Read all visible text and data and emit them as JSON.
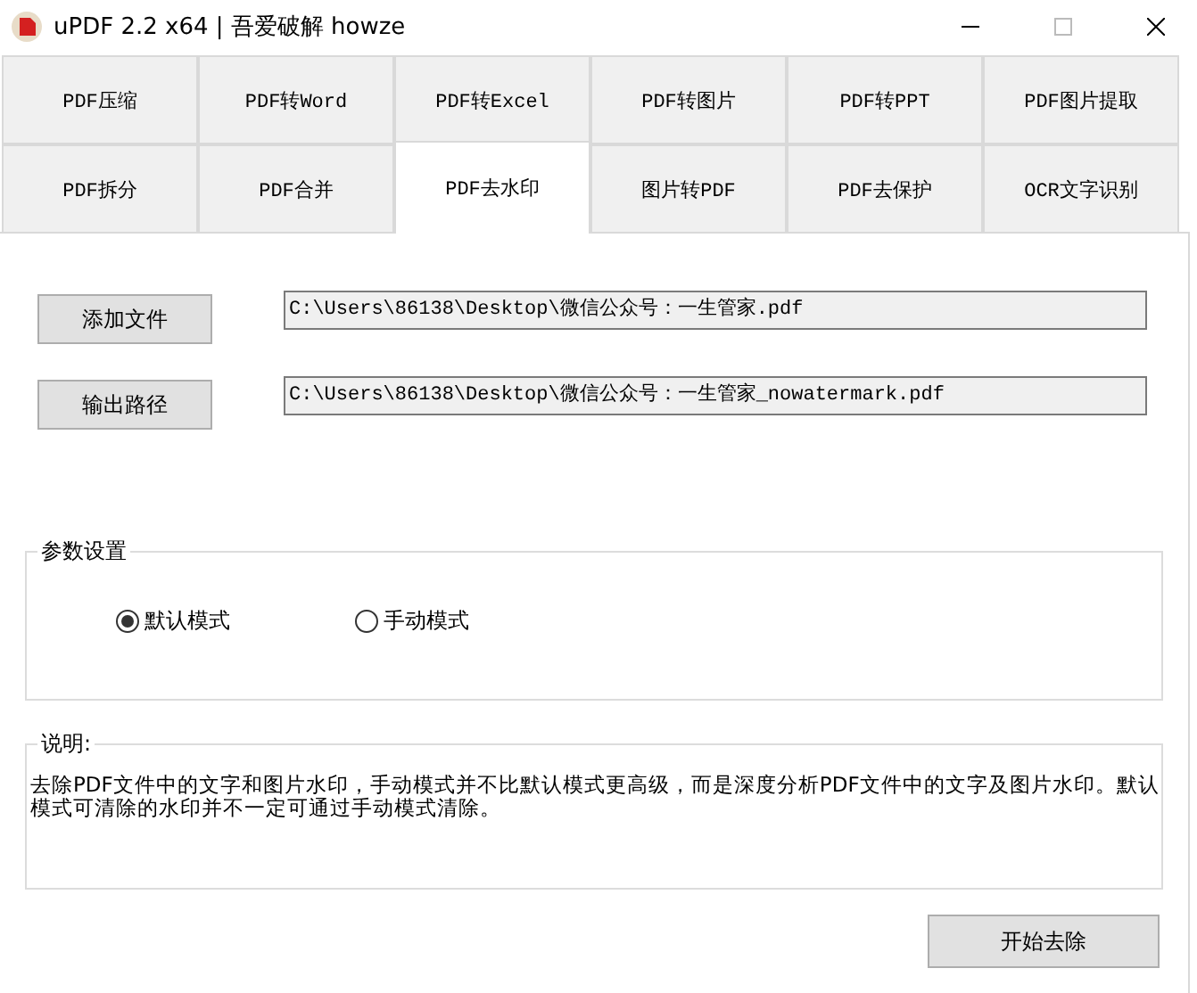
{
  "window": {
    "title": "uPDF 2.2 x64 | 吾爱破解 howze"
  },
  "tab_rows": [
    [
      {
        "label": "PDF压缩",
        "selected": false
      },
      {
        "label": "PDF转Word",
        "selected": false
      },
      {
        "label": "PDF转Excel",
        "selected": false
      },
      {
        "label": "PDF转图片",
        "selected": false
      },
      {
        "label": "PDF转PPT",
        "selected": false
      },
      {
        "label": "PDF图片提取",
        "selected": false
      }
    ],
    [
      {
        "label": "PDF拆分",
        "selected": false
      },
      {
        "label": "PDF合并",
        "selected": false
      },
      {
        "label": "PDF去水印",
        "selected": true
      },
      {
        "label": "图片转PDF",
        "selected": false
      },
      {
        "label": "PDF去保护",
        "selected": false
      },
      {
        "label": "OCR文字识别",
        "selected": false
      }
    ]
  ],
  "files": [
    {
      "button": "添加文件",
      "value": "C:\\Users\\86138\\Desktop\\微信公众号：一生管家.pdf"
    },
    {
      "button": "输出路径",
      "value": "C:\\Users\\86138\\Desktop\\微信公众号：一生管家_nowatermark.pdf"
    }
  ],
  "settings": {
    "title": "参数设置",
    "options": [
      {
        "label": "默认模式",
        "selected": true
      },
      {
        "label": "手动模式",
        "selected": false
      }
    ]
  },
  "description": {
    "title": "说明:",
    "text": "去除PDF文件中的文字和图片水印，手动模式并不比默认模式更高级，而是深度分析PDF文件中的文字及图片水印。默认模式可清除的水印并不一定可通过手动模式清除。"
  },
  "start_button": "开始去除"
}
